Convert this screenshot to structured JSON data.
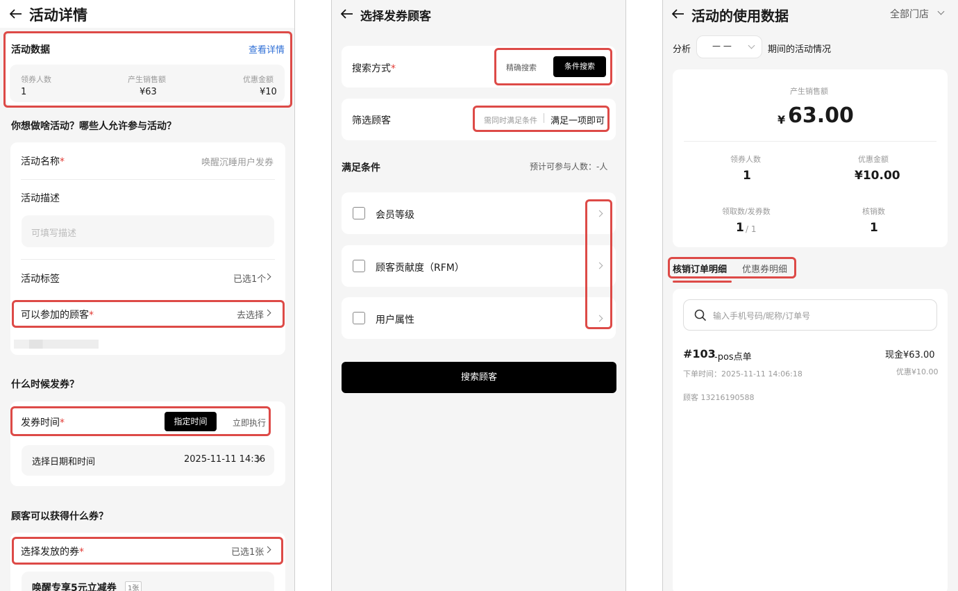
{
  "screen1": {
    "title": "活动详情",
    "stats": {
      "heading": "活动数据",
      "link": "查看详情",
      "items": [
        {
          "label": "领券人数",
          "value": "1"
        },
        {
          "label": "产生销售额",
          "value": "¥63"
        },
        {
          "label": "优惠金额",
          "value": "¥10"
        }
      ]
    },
    "section1_title": "你想做啥活动？哪些人允许参与活动？",
    "name_label": "活动名称",
    "name_value": "唤醒沉睡用户发券",
    "desc_label": "活动描述",
    "desc_placeholder": "可填写描述",
    "tag_label": "活动标签",
    "tag_value": "已选1个",
    "customer_label": "可以参加的顾客",
    "customer_value": "去选择",
    "section2_title": "什么时候发券？",
    "time_label": "发券时间",
    "time_opt_selected": "指定时间",
    "time_opt_other": "立即执行",
    "datetime_label": "选择日期和时间",
    "datetime_value": "2025-11-11 14:36",
    "section3_title": "顾客可以获得什么券？",
    "coupon_label": "选择发放的券",
    "coupon_value": "已选1张",
    "coupon_item": "唤醒专享5元立减券",
    "coupon_count": "1张"
  },
  "screen2": {
    "title": "选择发券顾客",
    "search_label": "搜索方式",
    "search_opt_exact": "精确搜索",
    "search_opt_cond": "条件搜索",
    "filter_label": "筛选顾客",
    "filter_opt_all": "需同时满足条件",
    "filter_opt_any": "满足一项即可",
    "cond_title": "满足条件",
    "cond_estimate": "预计可参与人数：-人",
    "conditions": [
      "会员等级",
      "顾客贡献度（RFM）",
      "用户属性"
    ],
    "search_button": "搜索顾客"
  },
  "screen3": {
    "title": "活动的使用数据",
    "store": "全部门店",
    "analysis_label": "分析",
    "period_value": "— —",
    "period_suffix": "期间的活动情况",
    "sales_label": "产生销售额",
    "currency": "¥",
    "sales_value": "63.00",
    "stats": [
      {
        "label": "领券人数",
        "value": "1"
      },
      {
        "label": "优惠金额",
        "value": "¥10.00"
      },
      {
        "label": "领取数/发券数",
        "value": "1",
        "sub": "/ 1"
      },
      {
        "label": "核销数",
        "value": "1"
      }
    ],
    "tab_active": "核销订单明细",
    "tab_other": "优惠券明细",
    "search_placeholder": "输入手机号码/昵称/订单号",
    "order": {
      "number": "#103",
      "type": "-pos点单",
      "amount": "现金¥63.00",
      "time": "下单时间：2025-11-11 14:06:18",
      "discount": "优惠¥10.00",
      "customer": "顾客 13216190588"
    }
  }
}
